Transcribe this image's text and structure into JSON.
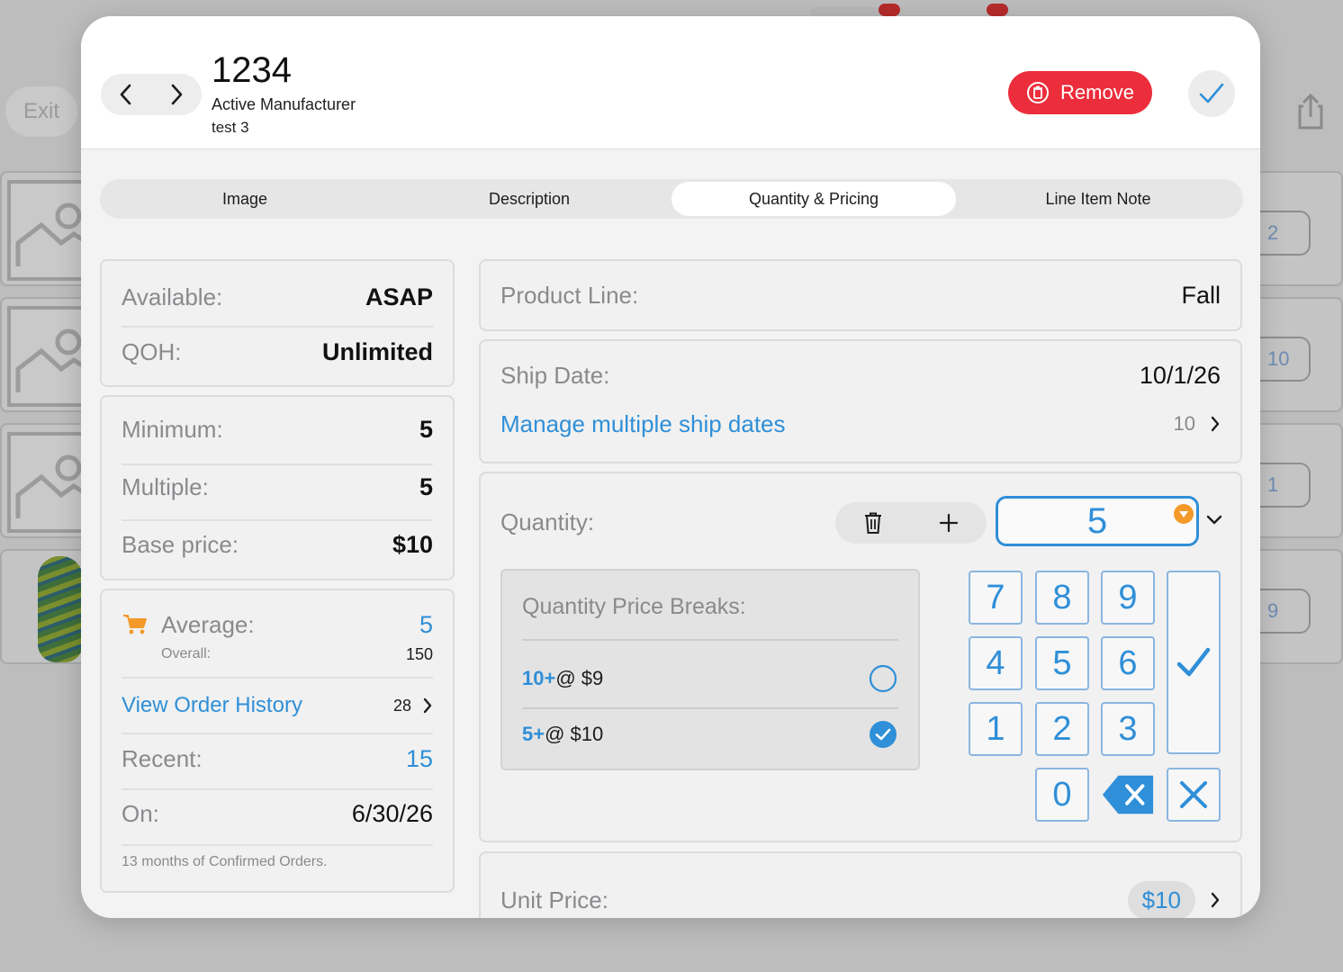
{
  "background": {
    "exit_label": "Exit",
    "row_quantities": [
      "2",
      "10",
      "1",
      "9"
    ]
  },
  "header": {
    "title": "1234",
    "manufacturer": "Active Manufacturer",
    "subtitle": "test 3",
    "remove_label": "Remove"
  },
  "tabs": [
    {
      "label": "Image",
      "active": false
    },
    {
      "label": "Description",
      "active": false
    },
    {
      "label": "Quantity & Pricing",
      "active": true
    },
    {
      "label": "Line Item Note",
      "active": false
    }
  ],
  "availability": {
    "available_label": "Available:",
    "available_value": "ASAP",
    "qoh_label": "QOH:",
    "qoh_value": "Unlimited"
  },
  "pricing": {
    "minimum_label": "Minimum:",
    "minimum_value": "5",
    "multiple_label": "Multiple:",
    "multiple_value": "5",
    "base_price_label": "Base price:",
    "base_price_value": "$10"
  },
  "history": {
    "average_label": "Average:",
    "average_value": "5",
    "overall_label": "Overall:",
    "overall_value": "150",
    "view_history_label": "View Order History",
    "view_history_count": "28",
    "recent_label": "Recent:",
    "recent_value": "15",
    "on_label": "On:",
    "on_value": "6/30/26",
    "footnote": "13 months of Confirmed Orders."
  },
  "product_line": {
    "label": "Product Line:",
    "value": "Fall"
  },
  "ship_date": {
    "label": "Ship Date:",
    "value": "10/1/26",
    "manage_label": "Manage multiple ship dates",
    "manage_count": "10"
  },
  "quantity": {
    "label": "Quantity:",
    "value": "5",
    "price_breaks_title": "Quantity Price Breaks:",
    "price_breaks": [
      {
        "qty": "10+",
        "price": "@ $9",
        "selected": false
      },
      {
        "qty": "5+",
        "price": "@ $10",
        "selected": true
      }
    ]
  },
  "keypad": {
    "keys": [
      "7",
      "8",
      "9",
      "4",
      "5",
      "6",
      "1",
      "2",
      "3",
      "0"
    ]
  },
  "unit_price": {
    "label": "Unit Price:",
    "value": "$10"
  },
  "colors": {
    "accent": "#2f8fd8",
    "remove": "#ec2d3b",
    "cart_icon": "#f39a2b"
  },
  "icons": [
    "chevron-left-icon",
    "chevron-right-icon",
    "trash-icon",
    "checkmark-icon",
    "share-icon",
    "cart-icon",
    "plus-icon",
    "backspace-icon",
    "close-icon",
    "chevron-down-icon"
  ]
}
